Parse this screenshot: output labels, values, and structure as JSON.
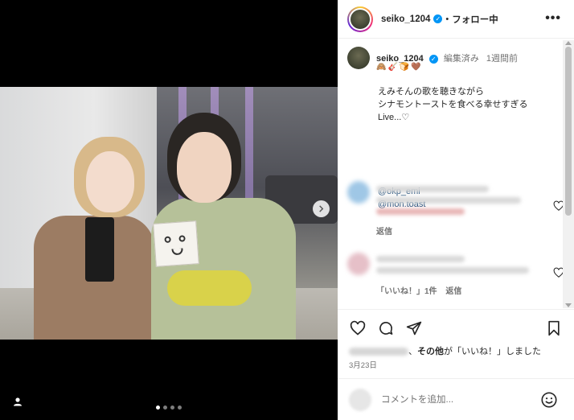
{
  "post": {
    "username": "seiko_1204",
    "follow_label": "フォロー中",
    "more_label": "•••",
    "caption": {
      "username": "seiko_1204",
      "edited_label": "編集済み",
      "time_ago": "1週間前",
      "emojis": "🙈🎸🍞🤎",
      "text": "えみそんの歌を聴きながら\nシナモントーストを食べる幸せすぎる\nLive...♡",
      "mentions": [
        "@okp_emi",
        "@mon.toast"
      ]
    },
    "comments": [
      {
        "reply_label": "返信"
      },
      {
        "likes_label": "「いいね！」1件",
        "reply_label": "返信"
      }
    ],
    "likes_text": {
      "others": "その他",
      "middle": "が「いいね！」しました",
      "prefix": "、"
    },
    "date": "3月23日",
    "add_comment": {
      "placeholder": "コメントを追加..."
    }
  },
  "media": {
    "carousel_count": 4,
    "active_index": 0
  },
  "colors": {
    "verified": "#0095f6",
    "link": "#00376b",
    "muted": "#737373"
  }
}
